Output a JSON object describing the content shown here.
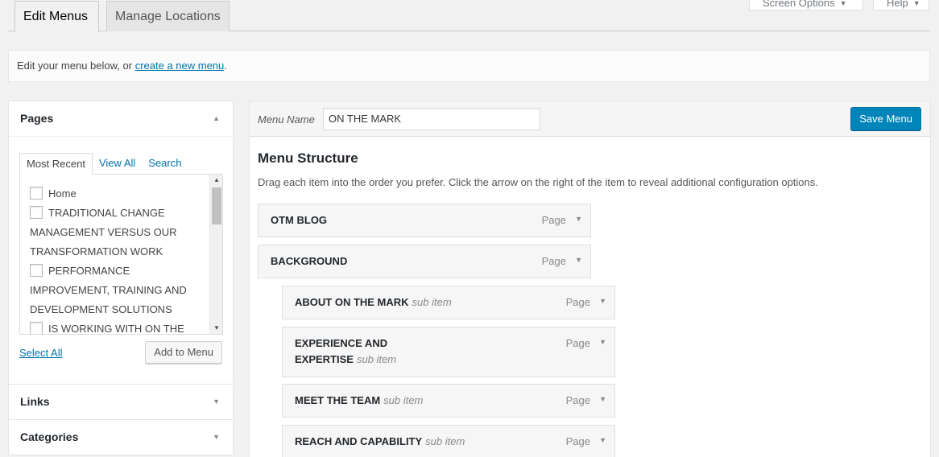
{
  "screen_meta": {
    "screen_options": "Screen Options",
    "help": "Help"
  },
  "tabs": {
    "edit_menus": "Edit Menus",
    "manage_locations": "Manage Locations"
  },
  "notice": {
    "prefix": "Edit your menu below, or ",
    "link": "create a new menu",
    "suffix": "."
  },
  "pages_box": {
    "title": "Pages",
    "tabs": [
      "Most Recent",
      "View All",
      "Search"
    ],
    "items": [
      "Home",
      "TRADITIONAL CHANGE MANAGEMENT VERSUS OUR TRANSFORMATION WORK",
      "PERFORMANCE IMPROVEMENT, TRAINING AND DEVELOPMENT SOLUTIONS",
      "IS WORKING WITH ON THE"
    ],
    "select_all": "Select All",
    "add_to_menu": "Add to Menu"
  },
  "links_box": {
    "title": "Links"
  },
  "categories_box": {
    "title": "Categories"
  },
  "menu": {
    "name_label": "Menu Name",
    "name_value": "ON THE MARK",
    "save_label": "Save Menu",
    "structure_title": "Menu Structure",
    "instructions": "Drag each item into the order you prefer. Click the arrow on the right of the item to reveal additional configuration options.",
    "items": [
      {
        "title": "OTM BLOG",
        "sub": "",
        "type": "Page"
      },
      {
        "title": "BACKGROUND",
        "sub": "",
        "type": "Page"
      },
      {
        "title": "ABOUT ON THE MARK",
        "sub": "sub item",
        "type": "Page"
      },
      {
        "title": "EXPERIENCE AND EXPERTISE",
        "sub": "sub item",
        "type": "Page"
      },
      {
        "title": "MEET THE TEAM",
        "sub": "sub item",
        "type": "Page"
      },
      {
        "title": "REACH AND CAPABILITY",
        "sub": "sub item",
        "type": "Page"
      }
    ]
  }
}
